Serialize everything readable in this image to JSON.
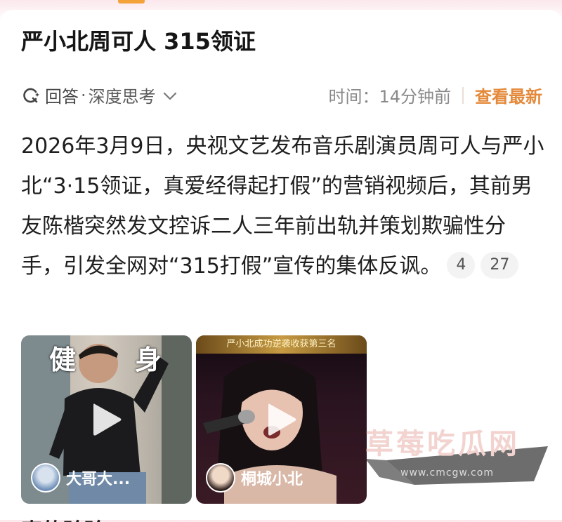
{
  "post": {
    "title": "严小北周可人 315领证",
    "meta": {
      "source": "回答",
      "dot": "·",
      "category": "深度思考",
      "time_label": "时间：14分钟前",
      "latest_label": "查看最新"
    },
    "body": "2026年3月9日，央视文艺发布音乐剧演员周可人与严小北“3·15领证，真爱经得起打假”的营销视频后，其前男友陈楷突然发文控诉二人三年前出轨并策划欺骗性分手，引发全网对“315打假”宣传的集体反讽。",
    "reference_pills": [
      "4",
      "27"
    ]
  },
  "videos": [
    {
      "overlay_chars": [
        "健",
        "身"
      ],
      "author": "大哥大..."
    },
    {
      "banner": "严小北成功逆袭收获第三名",
      "author": "桐城小北"
    }
  ],
  "watermark": {
    "title": "草莓吃瓜网",
    "url": "www.cmcgw.com"
  },
  "next_section": "真的验验",
  "colors": {
    "accent": "#e4893a",
    "top_tab": "#f4a23a"
  }
}
